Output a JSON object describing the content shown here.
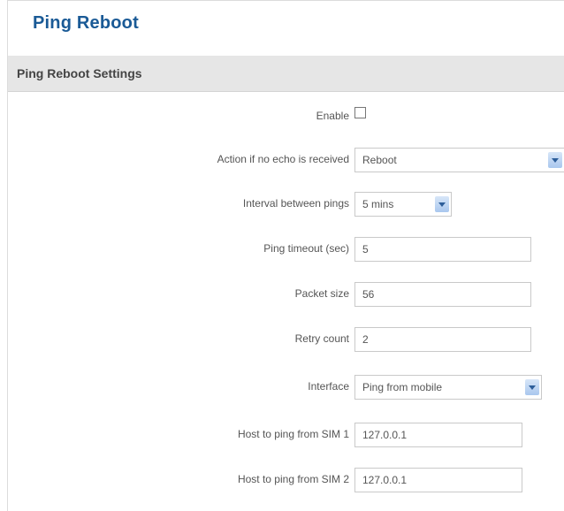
{
  "page": {
    "title": "Ping Reboot"
  },
  "section": {
    "title": "Ping Reboot Settings"
  },
  "form": {
    "enable": {
      "label": "Enable",
      "checked": false
    },
    "action": {
      "label": "Action if no echo is received",
      "value": "Reboot",
      "arrow_icon": "chevron-down-icon"
    },
    "interval": {
      "label": "Interval between pings",
      "value": "5 mins",
      "arrow_icon": "chevron-down-icon"
    },
    "timeout": {
      "label": "Ping timeout (sec)",
      "value": "5"
    },
    "packet_size": {
      "label": "Packet size",
      "value": "56"
    },
    "retry_count": {
      "label": "Retry count",
      "value": "2"
    },
    "interface": {
      "label": "Interface",
      "value": "Ping from mobile",
      "arrow_icon": "chevron-down-icon"
    },
    "host_sim1": {
      "label": "Host to ping from SIM 1",
      "value": "127.0.0.1"
    },
    "host_sim2": {
      "label": "Host to ping from SIM 2",
      "value": "127.0.0.1"
    }
  },
  "colors": {
    "title": "#1a5a96",
    "section_bg": "#e6e6e6",
    "select_arrow": "#a9c7ee"
  }
}
